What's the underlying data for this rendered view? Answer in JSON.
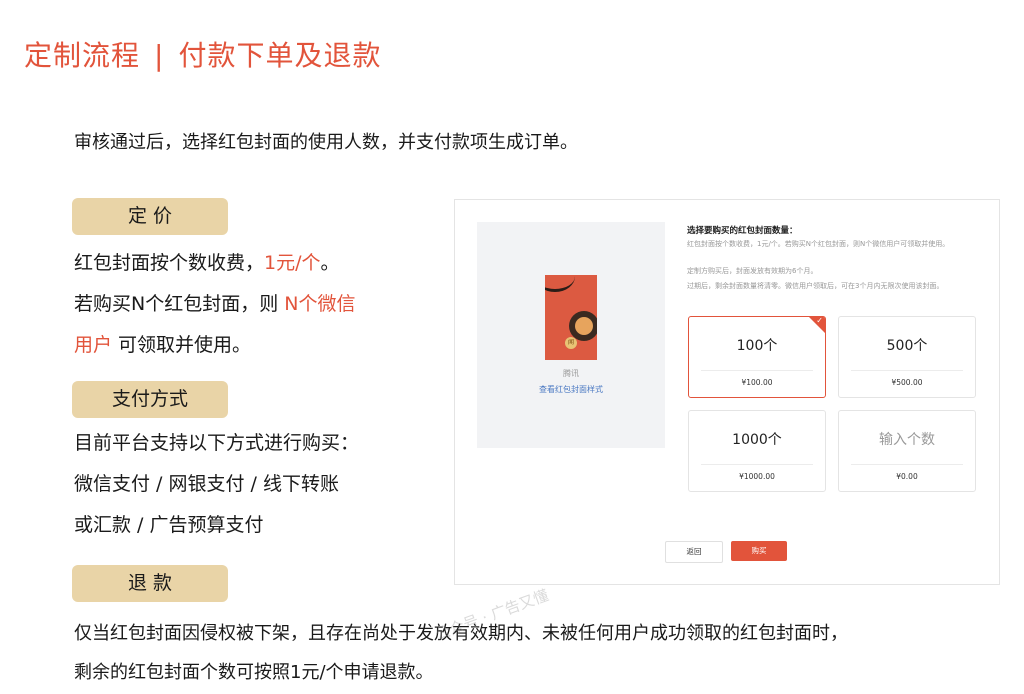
{
  "header": {
    "section": "定制流程",
    "divider": "|",
    "topic": "付款下单及退款"
  },
  "intro": "审核通过后，选择红包封面的使用人数，并支付款项生成订单。",
  "pricing": {
    "label": "定 价",
    "line1_a": "红包封面按个数收费，",
    "line1_b": "1元/个",
    "line1_c": "。",
    "line2_a": "若购买N个红包封面，则 ",
    "line2_b": "N个微信",
    "line3_a": "用户",
    "line3_b": " 可领取并使用。"
  },
  "payment": {
    "label": "支付方式",
    "lines": [
      "目前平台支持以下方式进行购买：",
      "微信支付 / 网银支付 / 线下转账",
      "或汇款 / 广告预算支付"
    ]
  },
  "refund": {
    "label": "退 款",
    "lines": [
      "仅当红包封面因侵权被下架，且存在尚处于发放有效期内、未被任何用户成功领取的红包封面时，",
      "剩余的红包封面个数可按照1元/个申请退款。"
    ]
  },
  "mockup": {
    "cover_name": "腾讯",
    "cover_coin": "闻",
    "view_link": "查看红包封面样式",
    "select_title": "选择要购买的红包封面数量：",
    "desc": [
      "红包封面按个数收费，1元/个。若购买N个红包封面，则N个微信用户可领取并使用。",
      "定制方购买后，封面发放有效期为6个月。",
      "过期后，剩余封面数量将清零。微信用户领取后，可在3个月内无限次使用该封面。"
    ],
    "options": [
      {
        "count": "100个",
        "price": "¥100.00",
        "selected": true
      },
      {
        "count": "500个",
        "price": "¥500.00",
        "selected": false
      },
      {
        "count": "1000个",
        "price": "¥1000.00",
        "selected": false
      },
      {
        "count": "输入个数",
        "price": "¥0.00",
        "selected": false
      }
    ],
    "check_mark": "✓",
    "back_label": "返回",
    "buy_label": "购买"
  },
  "watermark": "公众号 · 广告又懂",
  "colors": {
    "accent": "#e2543b",
    "pill": "#e9d4a7",
    "link": "#4a78c2"
  }
}
